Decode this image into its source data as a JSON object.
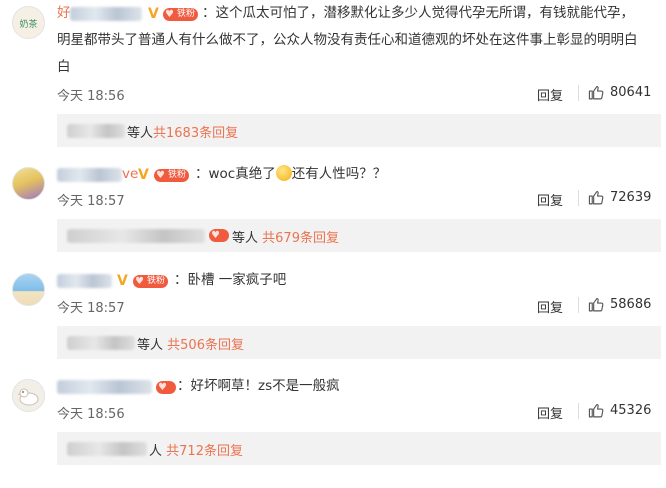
{
  "comments": [
    {
      "name_visible": "好",
      "avatar_text": "奶茶",
      "badge": "铁粉",
      "text": "：这个瓜太可怕了，潜移默化让多少人觉得代孕无所谓，有钱就能代孕，明星都带头了普通人有什么做不了，公众人物没有责任心和道德观的坏处在这件事上彰显的明明白白",
      "lines": [
        "：这个瓜太可怕了，潜移默化让多少人觉得代孕无所谓，有钱就能代孕，",
        "明星都带头了普通人有什么做不了，公众人物没有责任心和道德观的坏处在这件事上彰显的明明白",
        "白"
      ],
      "time": "今天 18:56",
      "reply": "回复",
      "likes": "80641",
      "sub_suffix": "等人",
      "sub_count": "共1683条回复"
    },
    {
      "name_visible": "ve",
      "badge": "铁粉",
      "text_before": "：woc真绝了",
      "text_after": "还有人性吗？？",
      "time": "今天 18:57",
      "reply": "回复",
      "likes": "72639",
      "sub_suffix": "等人",
      "sub_count": "共679条回复"
    },
    {
      "badge": "铁粉",
      "text": "：卧槽 一家疯子吧",
      "time": "今天 18:57",
      "reply": "回复",
      "likes": "58686",
      "sub_suffix": "等人",
      "sub_count": "共506条回复"
    },
    {
      "text": "：好坏啊草！zs不是一般疯",
      "time": "今天 18:56",
      "reply": "回复",
      "likes": "45326",
      "sub_suffix": "人",
      "sub_count": "共712条回复"
    }
  ],
  "colors": {
    "accent": "#eb7350",
    "vip": "#f5a623",
    "fan_badge": "#f05a3e",
    "sub_bg": "#f2f2f2"
  },
  "icons": {
    "like": "thumbs-up-icon",
    "vip": "v-badge-icon"
  }
}
